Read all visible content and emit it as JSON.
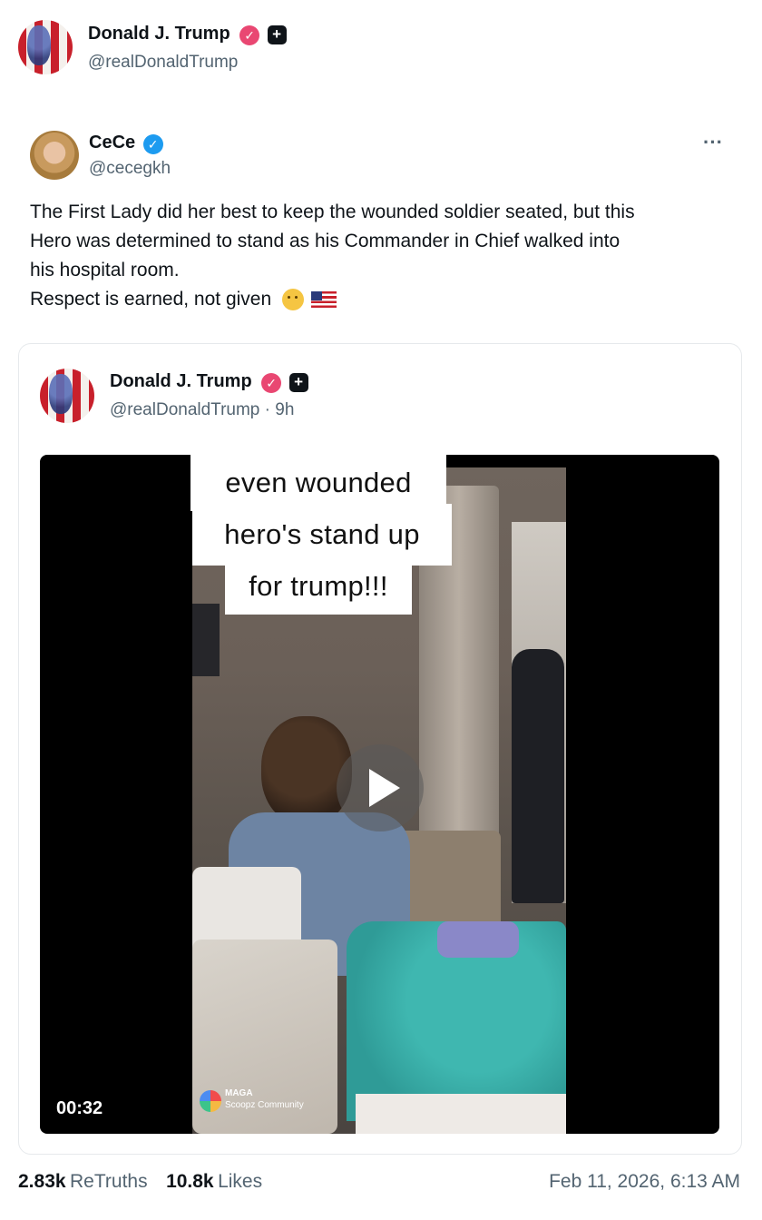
{
  "author": {
    "name": "Donald J. Trump",
    "handle": "@realDonaldTrump",
    "verified_icon": "verified-badge-icon",
    "extra_icon": "plus-square-icon"
  },
  "retruthed_post": {
    "name": "CeCe",
    "handle": "@cecegkh",
    "more_label": "···",
    "text_lines": [
      "The First Lady did her best to keep the wounded soldier seated, but this",
      "Hero was determined to stand as his Commander in Chief walked into",
      "his hospital room."
    ],
    "last_line": "Respect is earned, not given",
    "emoji": [
      "saluting-face-emoji",
      "us-flag-emoji"
    ]
  },
  "quoted_post": {
    "name": "Donald J. Trump",
    "handle": "@realDonaldTrump",
    "time": "· 9h",
    "video": {
      "caption_lines": [
        "even wounded",
        "hero's stand up",
        "for trump!!!"
      ],
      "duration": "00:32",
      "watermark_top": "MAGA",
      "watermark_bottom": "Scoopz Community"
    }
  },
  "stats": {
    "retruths_count": "2.83k",
    "retruths_label": "ReTruths",
    "likes_count": "10.8k",
    "likes_label": "Likes",
    "date": "Feb 11, 2026, 6:13 AM"
  },
  "colors": {
    "verified_pink": "#e94772",
    "verified_blue": "#1d9bf0",
    "muted_text": "#536471"
  }
}
